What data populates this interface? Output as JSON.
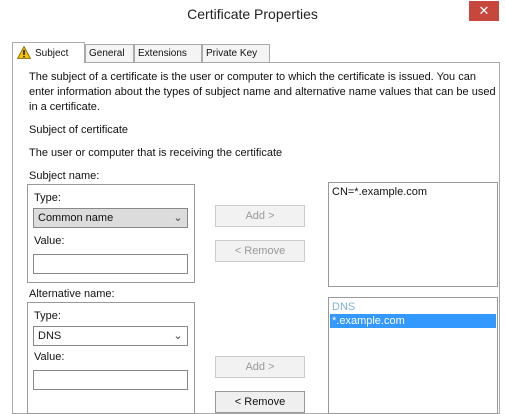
{
  "window": {
    "title": "Certificate Properties",
    "close_glyph": "✕"
  },
  "tabs": [
    {
      "label": "Subject",
      "icon": "warning-icon"
    },
    {
      "label": "General"
    },
    {
      "label": "Extensions"
    },
    {
      "label": "Private Key"
    }
  ],
  "subject_tab": {
    "description": "The subject of a certificate is the user or computer to which the certificate is issued. You can enter information about the types of subject name and alternative name values that can be used in a certificate.",
    "section_title": "Subject of certificate",
    "section_subtitle": "The user or computer that is receiving the certificate",
    "subject_name": {
      "group_label": "Subject name:",
      "type_label": "Type:",
      "type_value": "Common name",
      "value_label": "Value:",
      "value": "",
      "add_label": "Add >",
      "remove_label": "< Remove",
      "list": [
        "CN=*.example.com"
      ]
    },
    "alternative_name": {
      "group_label": "Alternative name:",
      "type_label": "Type:",
      "type_value": "DNS",
      "value_label": "Value:",
      "value": "",
      "add_label": "Add >",
      "remove_label": "< Remove",
      "list_category": "DNS",
      "list": [
        "*.example.com"
      ]
    }
  },
  "colors": {
    "close_button": "#c7473d",
    "selection": "#3399ff",
    "warning": "#f2c200"
  }
}
